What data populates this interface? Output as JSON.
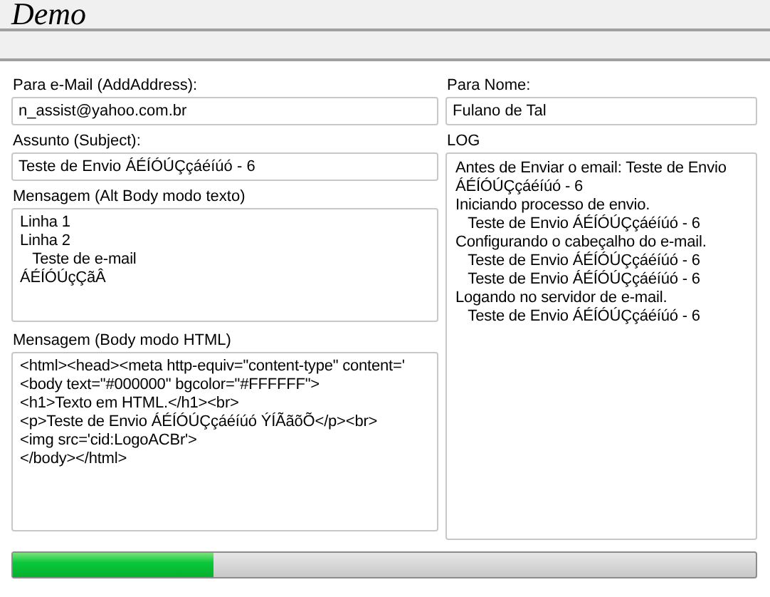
{
  "window": {
    "title": "Demo"
  },
  "to_email": {
    "label": "Para e-Mail (AddAddress):",
    "value": "n_assist@yahoo.com.br"
  },
  "to_name": {
    "label": "Para Nome:",
    "value": "Fulano de Tal"
  },
  "subject": {
    "label": "Assunto (Subject):",
    "value": "Teste de Envio ÁÉÍÓÚÇçáéíúó - 6"
  },
  "log": {
    "label": "LOG",
    "lines": [
      "Antes de Enviar o email: Teste de Envio",
      "ÁÉÍÓÚÇçáéíúó - 6",
      "Iniciando processo de envio.",
      "   Teste de Envio ÁÉÍÓÚÇçáéíúó - 6",
      "Configurando o cabeçalho do e-mail.",
      "   Teste de Envio ÁÉÍÓÚÇçáéíúó - 6",
      "   Teste de Envio ÁÉÍÓÚÇçáéíúó - 6",
      "Logando no servidor de e-mail.",
      "   Teste de Envio ÁÉÍÓÚÇçáéíúó - 6"
    ]
  },
  "alt_body": {
    "label": "Mensagem (Alt Body modo texto)",
    "lines": [
      "Linha 1",
      "Linha 2",
      "   Teste de e-mail",
      "ÁÉÍÓÚçÇãÂ"
    ]
  },
  "html_body": {
    "label": "Mensagem (Body modo HTML)",
    "lines": [
      "<html><head><meta http-equiv=\"content-type\" content='",
      "<body text=\"#000000\" bgcolor=\"#FFFFFF\">",
      "<h1>Texto em HTML.</h1><br>",
      "<p>Teste de Envio ÁÉÍÓÚÇçáéíúó ÝÍÃãõÕ</p><br>",
      "<img src='cid:LogoACBr'>",
      "</body></html>"
    ]
  },
  "progress": {
    "level": 0.27
  }
}
